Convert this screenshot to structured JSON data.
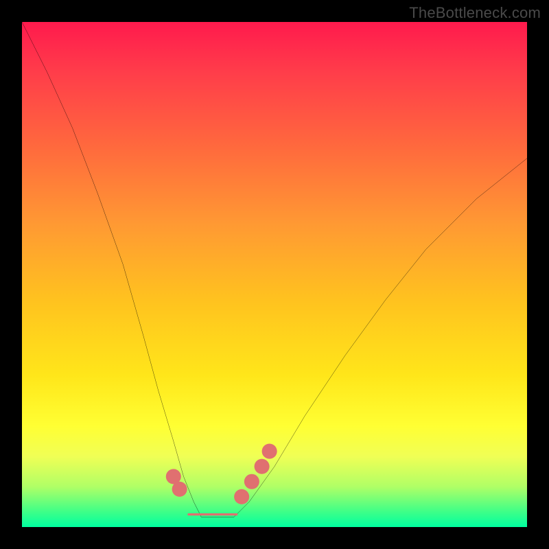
{
  "watermark": "TheBottleneck.com",
  "chart_data": {
    "type": "line",
    "title": "",
    "xlabel": "",
    "ylabel": "",
    "xlim": [
      0,
      100
    ],
    "ylim": [
      0,
      100
    ],
    "grid": false,
    "legend": false,
    "series": [
      {
        "name": "curve",
        "color": "#000000",
        "x": [
          0,
          5,
          10,
          15,
          20,
          24,
          27,
          30,
          32,
          34,
          35.5,
          39,
          42,
          45,
          50,
          56,
          64,
          72,
          80,
          90,
          100
        ],
        "y": [
          100,
          90,
          79,
          66,
          52,
          38,
          27,
          17,
          10,
          5,
          2,
          2,
          2,
          5,
          12,
          22,
          34,
          45,
          55,
          65,
          73
        ]
      },
      {
        "name": "dots-left",
        "type": "scatter",
        "color": "#e07070",
        "x": [
          30.0,
          31.2
        ],
        "y": [
          10.0,
          7.5
        ]
      },
      {
        "name": "dots-right",
        "type": "scatter",
        "color": "#e07070",
        "x": [
          43.5,
          45.5,
          47.5,
          49.0
        ],
        "y": [
          6.0,
          9.0,
          12.0,
          15.0
        ]
      },
      {
        "name": "flat-band",
        "type": "line",
        "color": "#e07070",
        "x": [
          33.0,
          42.5
        ],
        "y": [
          2.5,
          2.5
        ]
      }
    ],
    "annotations": []
  }
}
